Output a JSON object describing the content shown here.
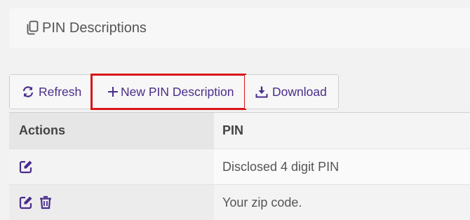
{
  "header": {
    "title": "PIN Descriptions",
    "icon": "copy-icon"
  },
  "toolbar": {
    "refresh_label": "Refresh",
    "new_label": "New PIN Description",
    "download_label": "Download"
  },
  "table": {
    "columns": [
      "Actions",
      "PIN"
    ],
    "rows": [
      {
        "pin": "Disclosed 4 digit PIN",
        "actions": [
          "edit-icon"
        ]
      },
      {
        "pin": "Your zip code.",
        "actions": [
          "edit-icon",
          "trash-icon"
        ]
      }
    ]
  },
  "colors": {
    "accent": "#4a2d8a",
    "highlight": "#d9161a"
  }
}
